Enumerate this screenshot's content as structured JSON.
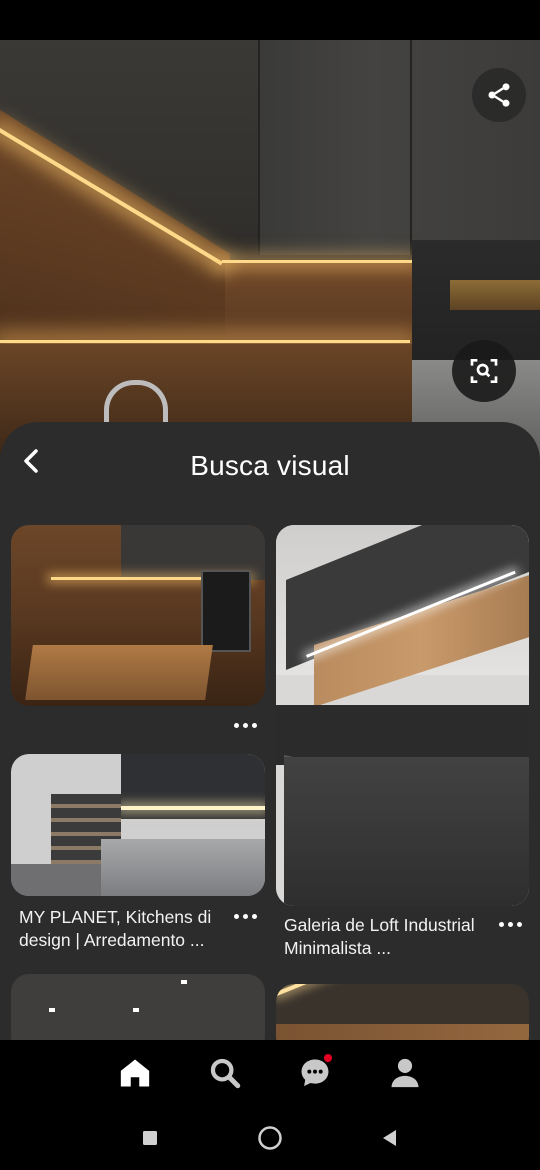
{
  "sheet": {
    "title": "Busca visual"
  },
  "pins": [
    {
      "caption": ""
    },
    {
      "caption": "Galeria de Loft Industrial Minimalista ..."
    },
    {
      "caption": "MY PLANET, Kitchens di design | Arredamento ..."
    }
  ],
  "icons": {
    "share": "share-icon",
    "lens": "visual-search-icon",
    "back": "chevron-left-icon",
    "more": "more-dots-icon",
    "home": "home-icon",
    "search": "search-icon",
    "messages": "chat-bubble-icon",
    "profile": "person-icon",
    "recents": "square-icon",
    "home_sys": "circle-icon",
    "back_sys": "triangle-back-icon"
  },
  "colors": {
    "sheet_bg": "#2c2c2c",
    "notification": "#e60023",
    "background": "#000000"
  }
}
